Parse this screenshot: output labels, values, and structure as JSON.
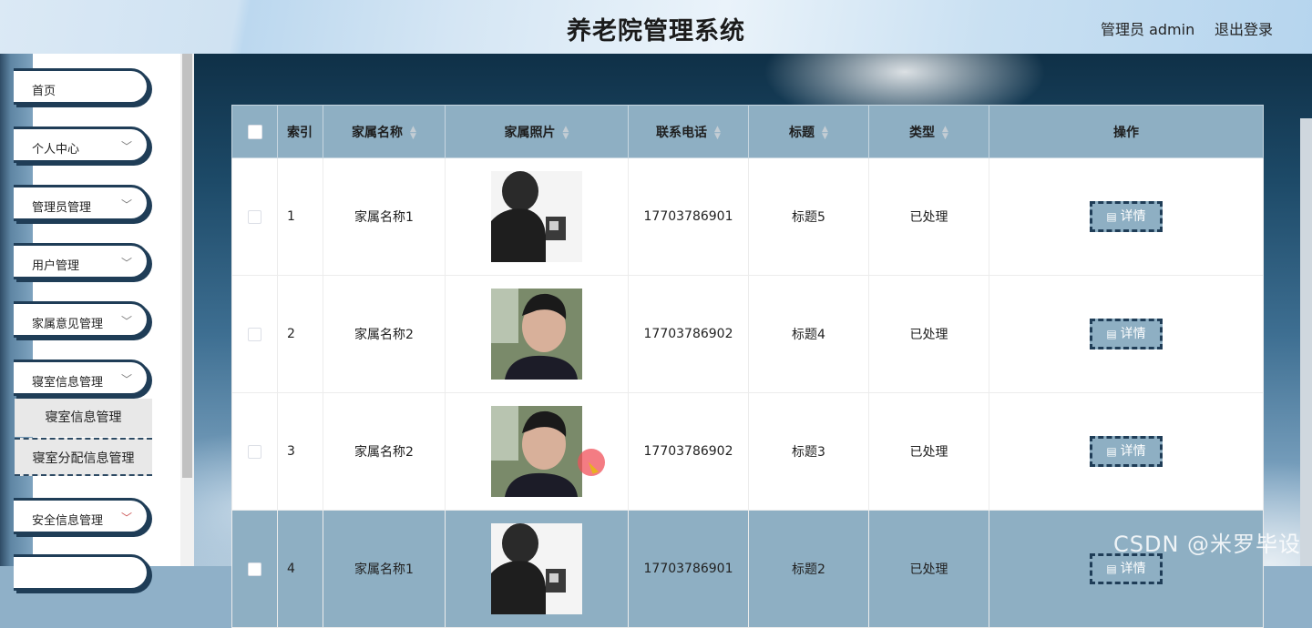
{
  "header": {
    "title": "养老院管理系统",
    "admin_label": "管理员 admin",
    "logout": "退出登录"
  },
  "sidebar": {
    "items": [
      {
        "label": "首页",
        "has_chevron": false
      },
      {
        "label": "个人中心",
        "has_chevron": true
      },
      {
        "label": "管理员管理",
        "has_chevron": true
      },
      {
        "label": "用户管理",
        "has_chevron": true
      },
      {
        "label": "家属意见管理",
        "has_chevron": true
      },
      {
        "label": "寝室信息管理",
        "has_chevron": true
      },
      {
        "label": "安全信息管理",
        "has_chevron": true
      }
    ],
    "submenu": [
      "寝室信息管理",
      "寝室分配信息管理"
    ]
  },
  "table": {
    "columns": [
      "索引",
      "家属名称",
      "家属照片",
      "联系电话",
      "标题",
      "类型",
      "操作"
    ],
    "rows": [
      {
        "index": "1",
        "name": "家属名称1",
        "photo": "photo-man-a",
        "phone": "17703786901",
        "title": "标题5",
        "type": "已处理",
        "action": "详情"
      },
      {
        "index": "2",
        "name": "家属名称2",
        "photo": "photo-man-b",
        "phone": "17703786902",
        "title": "标题4",
        "type": "已处理",
        "action": "详情"
      },
      {
        "index": "3",
        "name": "家属名称2",
        "photo": "photo-man-b",
        "phone": "17703786902",
        "title": "标题3",
        "type": "已处理",
        "action": "详情"
      },
      {
        "index": "4",
        "name": "家属名称1",
        "photo": "photo-man-a",
        "phone": "17703786901",
        "title": "标题2",
        "type": "已处理",
        "action": "详情"
      }
    ]
  },
  "watermark": "CSDN @米罗毕设",
  "colors": {
    "accent": "#8eafc3",
    "border_dark": "#1f3d57"
  }
}
